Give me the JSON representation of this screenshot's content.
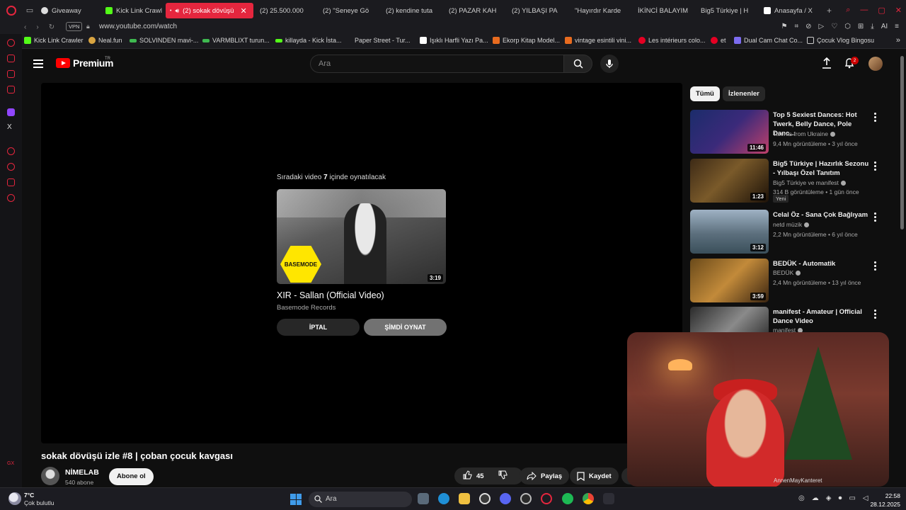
{
  "browser": {
    "tabs": [
      {
        "label": "Giveaway",
        "icon": "giveaway-icon"
      },
      {
        "label": "Kick Link Crawl",
        "icon": "kick-icon"
      },
      {
        "label": "(2) sokak dövüşü",
        "icon": "youtube-icon",
        "active": true
      },
      {
        "label": "(2) 25.500.000",
        "icon": "youtube-icon"
      },
      {
        "label": "(2) \"Seneye Gö",
        "icon": "youtube-icon"
      },
      {
        "label": "(2) kendine tuta",
        "icon": "youtube-icon"
      },
      {
        "label": "(2) PAZAR KAH",
        "icon": "youtube-icon"
      },
      {
        "label": "(2) YILBAŞI PA",
        "icon": "youtube-icon"
      },
      {
        "label": "\"Hayırdır Karde",
        "icon": "youtube-icon"
      },
      {
        "label": "İKİNCİ BALAYIM",
        "icon": "youtube-icon"
      },
      {
        "label": "Big5 Türkiye | H",
        "icon": "youtube-icon"
      },
      {
        "label": "Anasayfa / X",
        "icon": "x-icon"
      }
    ],
    "vpn_label": "VPN",
    "url": "www.youtube.com/watch",
    "accent_color": "#e5263e",
    "tools_ai_label": "AI"
  },
  "bookmarks": [
    {
      "label": "Kick Link Crawler",
      "color": "#53fc18"
    },
    {
      "label": "Neal.fun",
      "color": "#d9a441"
    },
    {
      "label": "SOLVINDEN mavi-...",
      "color": "#3fb950"
    },
    {
      "label": "VARMBLIXT turun...",
      "color": "#3fb950"
    },
    {
      "label": "killayda - Kick İsta...",
      "color": "#53fc18"
    },
    {
      "label": "Paper Street - Tur...",
      "color": "#e0e0e0"
    },
    {
      "label": "Işıklı Harfli Yazı Pa...",
      "color": "#ffffff"
    },
    {
      "label": "Ekorp Kitap Model...",
      "color": "#e86b1f"
    },
    {
      "label": "vintage esintili vini...",
      "color": "#e86b1f"
    },
    {
      "label": "Les intérieurs colo...",
      "color": "#e60023"
    },
    {
      "label": "et",
      "color": "#e60023"
    },
    {
      "label": "Dual Cam Chat Co...",
      "color": "#7c6cf0"
    },
    {
      "label": "Çocuk Vlog Bingosu",
      "color": "#e0e0e0"
    }
  ],
  "sidebar": {
    "x_label": "X",
    "gx_label": "GX"
  },
  "youtube": {
    "brand": "Premium",
    "region": "TR",
    "search_placeholder": "Ara",
    "notification_count": "2",
    "player": {
      "up_next_prefix": "Sıradaki video",
      "countdown": "7",
      "up_next_suffix": "içinde oynatılacak",
      "next_title": "XIR - Sallan (Official Video)",
      "next_channel": "Basemode Records",
      "next_duration": "3:19",
      "thumb_logo": "BASEMODE",
      "cancel_label": "İPTAL",
      "play_now_label": "ŞİMDİ OYNAT"
    },
    "video": {
      "title": "sokak dövüşü izle #8 | çoban çocuk kavgası",
      "channel": "NİMELAB",
      "subscribers": "540 abone",
      "subscribe_label": "Abone ol",
      "likes": "45",
      "share_label": "Paylaş",
      "save_label": "Kaydet"
    },
    "chips": [
      "Tümü",
      "İzlenenler"
    ],
    "recommendations": [
      {
        "title": "Top 5 Sexiest Dances: Hot Twerk, Belly Dance, Pole Danc...",
        "channel": "Talents from Ukraine",
        "meta": "9,4 Mn görüntüleme • 3 yıl önce",
        "duration": "11:46"
      },
      {
        "title": "Big5 Türkiye | Hazırlık Sezonu - Yılbaşı Özel Tanıtım",
        "channel": "Big5 Türkiye ve manifest",
        "meta": "314 B görüntüleme • 1 gün önce",
        "duration": "1:23",
        "badge": "Yeni"
      },
      {
        "title": "Celal Öz - Sana Çok Bağlıyam",
        "channel": "netd müzik",
        "meta": "2,2 Mn görüntüleme • 6 yıl önce",
        "duration": "3:12"
      },
      {
        "title": "BEDÜK - Automatik",
        "channel": "BEDÜK",
        "meta": "2,4 Mn görüntüleme • 13 yıl önce",
        "duration": "3:59"
      },
      {
        "title": "manifest - Amateur | Official Dance Video",
        "channel": "manifest",
        "meta": "",
        "duration": ""
      }
    ]
  },
  "webcam": {
    "name": "AnnenMayKanteret"
  },
  "taskbar": {
    "temperature": "7°C",
    "weather": "Çok bulutlu",
    "search_label": "Ara",
    "time": "22:58",
    "date": "28.12.2025"
  }
}
